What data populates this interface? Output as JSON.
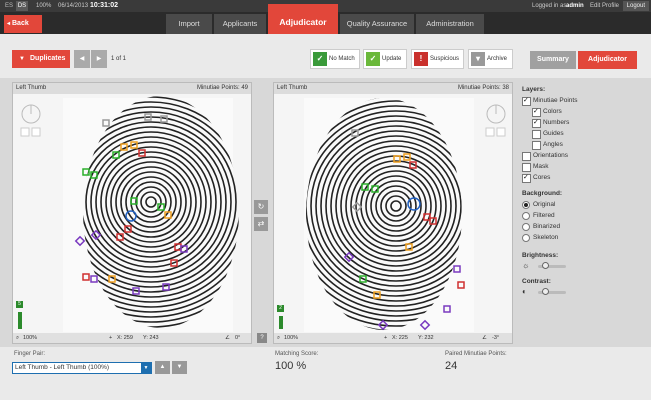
{
  "header": {
    "languages": [
      "ES",
      "DS"
    ],
    "active_language": "DS",
    "zoom": "100%",
    "date": "06/14/2013",
    "time": "10:31:02",
    "logged_in_prefix": "Logged in as:",
    "user": "admin",
    "edit_profile": "Edit Profile",
    "logout": "Logout"
  },
  "nav": {
    "back": "Back",
    "tabs": [
      {
        "label": "Import"
      },
      {
        "label": "Applicants"
      },
      {
        "label": "Adjudicator"
      },
      {
        "label": "Quality Assurance"
      },
      {
        "label": "Administration"
      }
    ],
    "active_tab": "Adjudicator"
  },
  "toolbar": {
    "duplicates": "Duplicates",
    "page_info": "1 of 1",
    "filters": [
      {
        "label": "No Match",
        "color": "#3a9a3a"
      },
      {
        "label": "Update",
        "color": "#6ab83a"
      },
      {
        "label": "Suspicious",
        "color": "#c9302c"
      },
      {
        "label": "Archive",
        "color": "#999999"
      }
    ],
    "summary": "Summary",
    "adjudicator": "Adjudicator"
  },
  "left_panel": {
    "title": "Left Thumb",
    "minutiae_points": "Minutiae Points: 49",
    "level": "5",
    "zoom": "100%",
    "x": "X: 259",
    "y": "Y: 243",
    "angle": "0°"
  },
  "right_panel": {
    "title": "Left Thumb",
    "minutiae_points": "Minutiae Points: 38",
    "level": "2",
    "zoom": "100%",
    "x": "X: 225",
    "y": "Y: 232",
    "angle": "-3°"
  },
  "layers": {
    "heading": "Layers:",
    "items": [
      {
        "label": "Minutiae Points",
        "checked": true,
        "indent": 0
      },
      {
        "label": "Colors",
        "checked": true,
        "indent": 1
      },
      {
        "label": "Numbers",
        "checked": true,
        "indent": 1
      },
      {
        "label": "Guides",
        "checked": false,
        "indent": 1
      },
      {
        "label": "Angles",
        "checked": false,
        "indent": 1
      },
      {
        "label": "Orientations",
        "checked": false,
        "indent": 0
      },
      {
        "label": "Mask",
        "checked": false,
        "indent": 0
      },
      {
        "label": "Cores",
        "checked": true,
        "indent": 0
      }
    ],
    "background_heading": "Background:",
    "backgrounds": [
      {
        "label": "Original",
        "selected": true
      },
      {
        "label": "Filtered",
        "selected": false
      },
      {
        "label": "Binarized",
        "selected": false
      },
      {
        "label": "Skeleton",
        "selected": false
      }
    ],
    "brightness": "Brightness:",
    "contrast": "Contrast:"
  },
  "bottom": {
    "finger_pair_label": "Finger Pair:",
    "finger_pair_value": "Left Thumb - Left Thumb (100%)",
    "matching_score_label": "Matching Score:",
    "matching_score": "100 %",
    "paired_minutiae_label": "Paired Minutiae Points:",
    "paired_minutiae": "24"
  }
}
